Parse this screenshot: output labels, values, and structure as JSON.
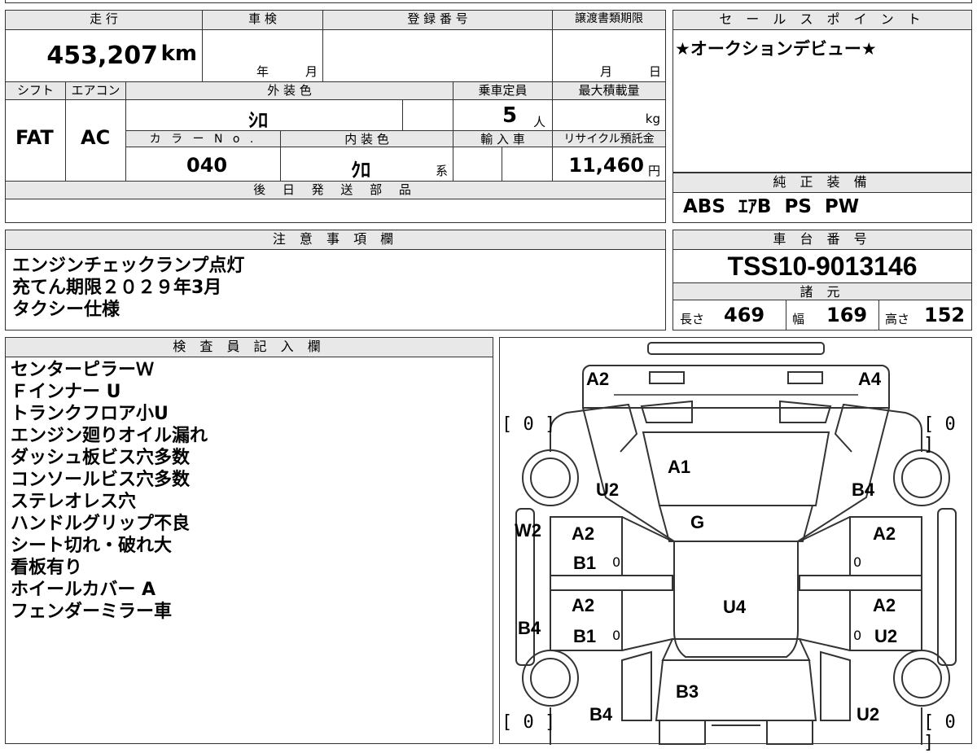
{
  "headers": {
    "mileage": "走 行",
    "shaken": "車 検",
    "registration": "登 録 番 号",
    "transfer_deadline": "譲渡書類期限",
    "shift": "シフト",
    "aircon": "エアコン",
    "exterior_color": "外 装 色",
    "capacity": "乗車定員",
    "max_load": "最大積載量",
    "color_no": "カ ラ ー N o .",
    "interior_color": "内 装 色",
    "import": "輸 入 車",
    "recycle": "リサイクル預託金",
    "later_parts": "後 日 発 送 部 品",
    "sales_point": "セ ー ル ス ポ イ ン ト",
    "genuine_equipment": "純 正 装 備",
    "notes": "注 意 事 項 欄",
    "chassis": "車 台 番 号",
    "specs": "諸 元",
    "inspector": "検 査 員 記 入 欄"
  },
  "values": {
    "mileage": "453,207",
    "mileage_unit": "km",
    "shaken_year": "年",
    "shaken_month": "月",
    "transfer_month": "月",
    "transfer_day": "日",
    "shift": "FAT",
    "aircon": "AC",
    "exterior_color": "ｼﾛ",
    "capacity": "5",
    "capacity_unit": "人",
    "max_load_unit": "kg",
    "color_no": "040",
    "interior_color": "ｸﾛ",
    "interior_suffix": "系",
    "recycle": "11,460",
    "recycle_unit": "円",
    "sales_point": "★オークションデビュー★",
    "genuine_equipment": "ABS  ｴｱB  PS  PW",
    "chassis": "TSS10-9013146",
    "length_label": "長さ",
    "length": "469",
    "width_label": "幅",
    "width": "169",
    "height_label": "高さ",
    "height": "152"
  },
  "notes": [
    "エンジンチェックランプ点灯",
    "充てん期限２０２９年3月",
    "タクシー仕様"
  ],
  "inspector_notes": [
    "センターピラーＷ",
    "Ｆインナー U",
    "トランクフロア小U",
    "エンジン廻りオイル漏れ",
    "ダッシュ板ビス穴多数",
    "コンソールビス穴多数",
    "ステレオレス穴",
    "ハンドルグリップ不良",
    "シート切れ・破れ大",
    "看板有り",
    "ホイールカバー A",
    "フェンダーミラー車"
  ],
  "diagram": {
    "a2_left": "A2",
    "a4": "A4",
    "tire_fl": "[ 0 ]",
    "tire_fr": "[ 0 ]",
    "tire_rl": "[ 0 ]",
    "tire_rr": "[ 0 ]",
    "a1": "A1",
    "u2_fl": "U2",
    "b4_fr": "B4",
    "g": "G",
    "w2": "W2",
    "a2_fld": "A2",
    "b1_fld": "B1",
    "a2_frd": "A2",
    "a2_rld": "A2",
    "b1_rld": "B1",
    "u4": "U4",
    "a2_rrd": "A2",
    "u2_rrd": "U2",
    "b4_left": "B4",
    "b3": "B3",
    "b4_rear": "B4",
    "u2_rear": "U2",
    "zero_1": "0",
    "zero_2": "0",
    "zero_3": "0",
    "zero_4": "0"
  }
}
